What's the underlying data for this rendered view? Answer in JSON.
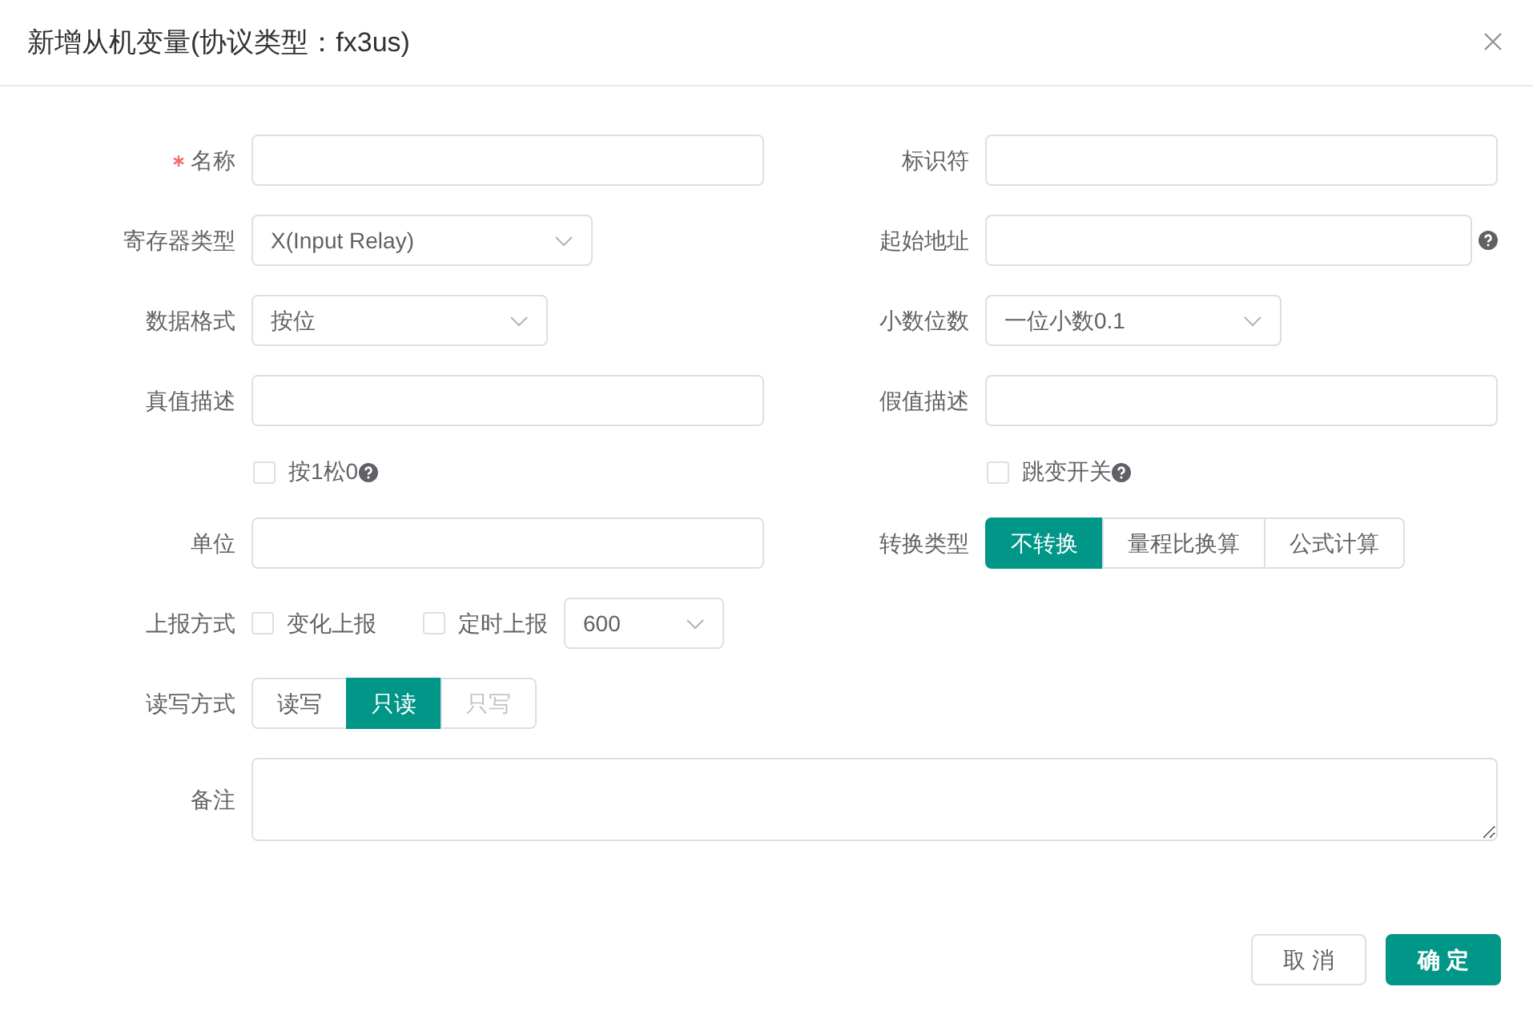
{
  "dialog": {
    "title": "新增从机变量(协议类型：fx3us)"
  },
  "rows": [
    [
      {
        "label": "名称",
        "required": true,
        "kind": "input"
      },
      {
        "label": "标识符",
        "kind": "input"
      }
    ],
    [
      {
        "label": "寄存器类型",
        "kind": "select",
        "value": "X(Input Relay)"
      },
      {
        "label": "起始地址",
        "kind": "input",
        "help": true
      }
    ],
    [
      {
        "label": "数据格式",
        "kind": "select",
        "value": "按位"
      },
      {
        "label": "小数位数",
        "kind": "select",
        "value": "一位小数0.1"
      }
    ],
    [
      {
        "label": "真值描述",
        "kind": "input"
      },
      {
        "label": "假值描述",
        "kind": "input"
      }
    ],
    [
      {
        "kind": "checkbox",
        "text": "按1松0",
        "checked": false,
        "help": true
      },
      {
        "kind": "checkbox",
        "text": "跳变开关",
        "checked": false,
        "help": true
      }
    ],
    [
      {
        "label": "单位",
        "kind": "input"
      },
      {
        "label": "转换类型",
        "kind": "segmented",
        "options": [
          {
            "text": "不转换",
            "selected": true,
            "disabled": false
          },
          {
            "text": "量程比换算",
            "selected": false,
            "disabled": false
          },
          {
            "text": "公式计算",
            "selected": false,
            "disabled": false
          }
        ]
      }
    ],
    [
      {
        "label": "上报方式",
        "kind": "group",
        "items": [
          {
            "kind": "checkbox",
            "text": "变化上报",
            "checked": false
          },
          {
            "kind": "checkbox",
            "text": "定时上报",
            "checked": false
          },
          {
            "kind": "select",
            "value": "600"
          }
        ]
      }
    ],
    [
      {
        "label": "读写方式",
        "kind": "segmented",
        "options": [
          {
            "text": "读写",
            "selected": false,
            "disabled": false
          },
          {
            "text": "只读",
            "selected": true,
            "disabled": false
          },
          {
            "text": "只写",
            "selected": false,
            "disabled": true
          }
        ]
      }
    ],
    [
      {
        "label": "备注",
        "kind": "textarea"
      }
    ]
  ],
  "buttons": [
    {
      "text": "取 消",
      "kind": "secondary"
    },
    {
      "text": "确 定",
      "kind": "primary"
    }
  ]
}
